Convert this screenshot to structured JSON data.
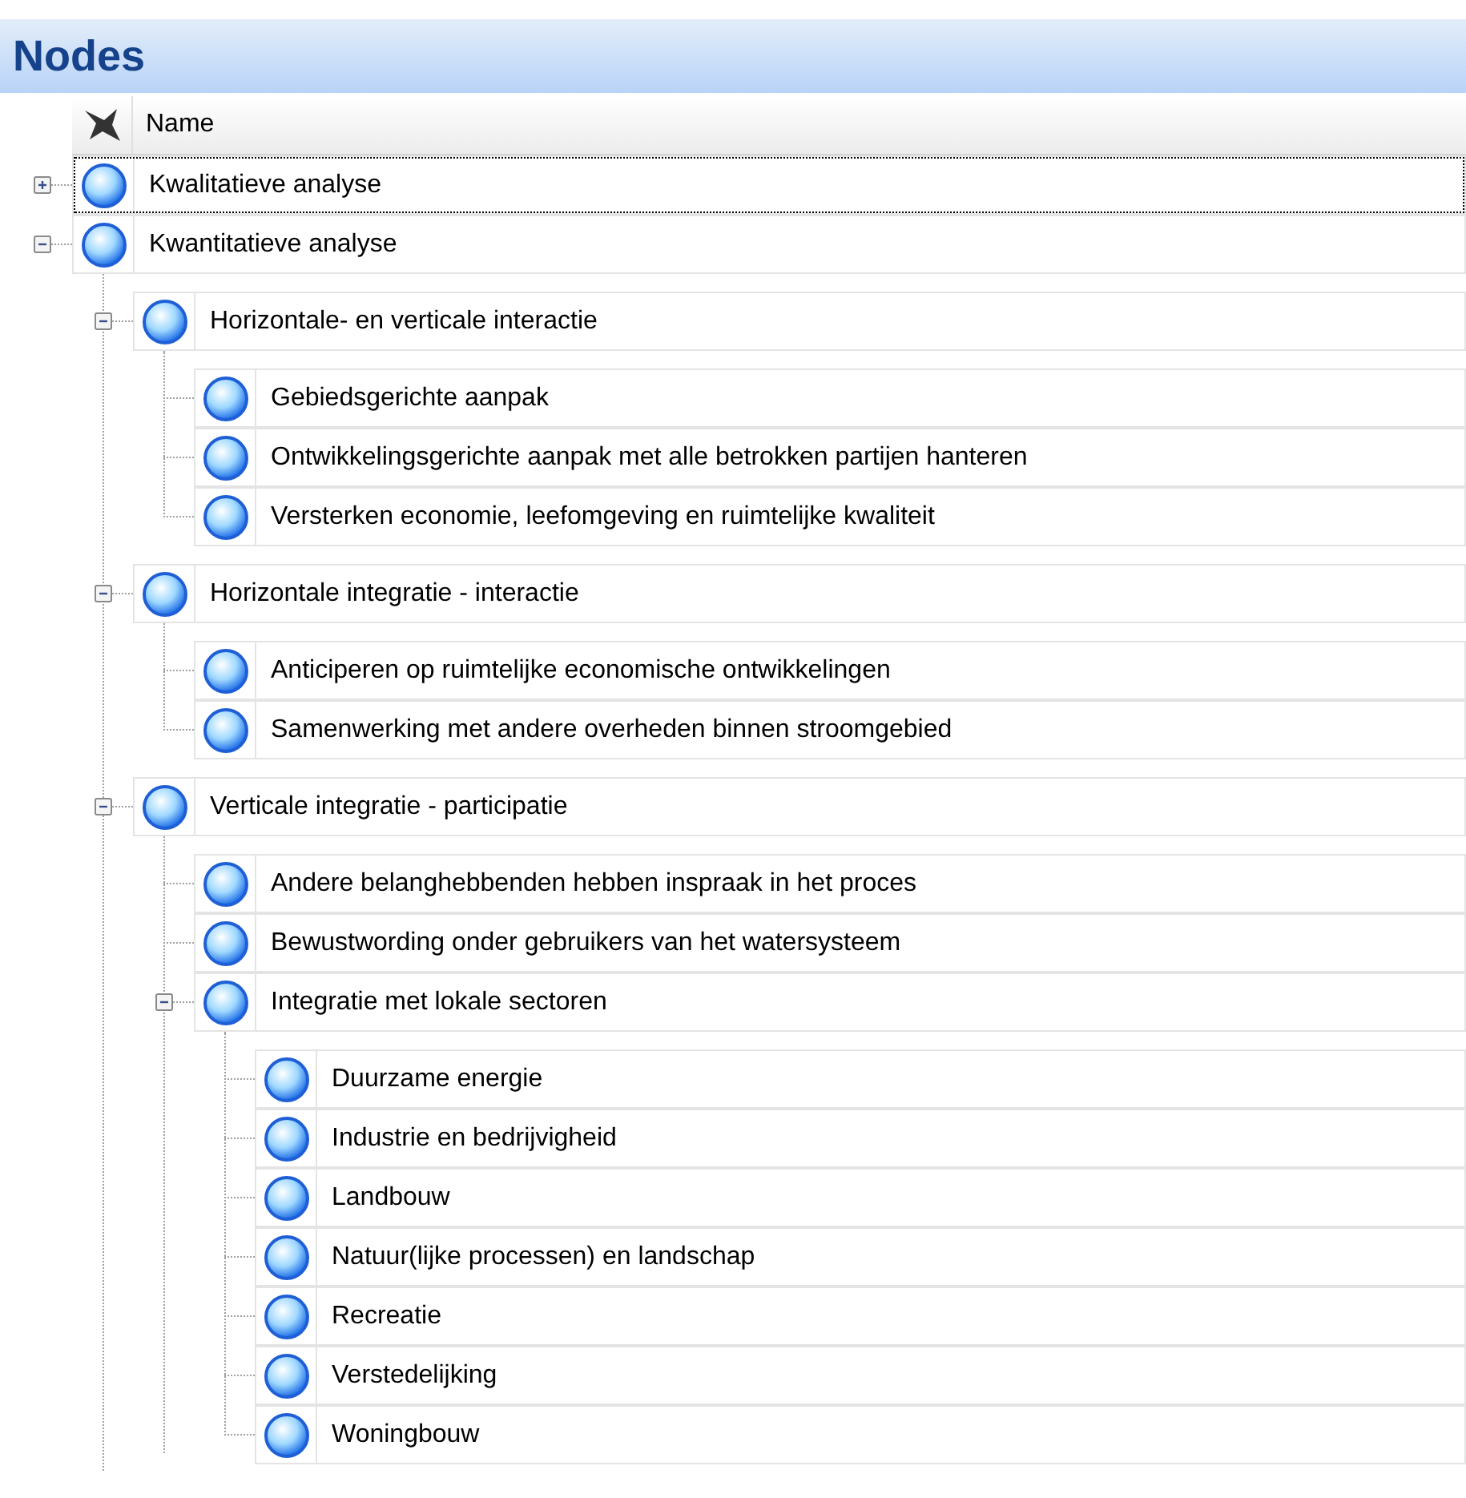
{
  "panel": {
    "title": "Nodes"
  },
  "columns": [
    {
      "label": "Name"
    }
  ],
  "nodes": [
    {
      "label": "Kwalitatieve analyse",
      "kind": "group",
      "expanded": false,
      "selected": true
    },
    {
      "label": "Kwantitatieve analyse",
      "kind": "group",
      "expanded": true,
      "selected": false,
      "children": [
        {
          "label": "Horizontale- en verticale interactie",
          "kind": "group",
          "expanded": true,
          "selected": false,
          "children": [
            {
              "label": "Gebiedsgerichte aanpak",
              "kind": "leaf",
              "selected": false
            },
            {
              "label": "Ontwikkelingsgerichte aanpak met alle betrokken partijen hanteren",
              "kind": "leaf",
              "selected": false
            },
            {
              "label": "Versterken economie, leefomgeving en ruimtelijke kwaliteit",
              "kind": "leaf",
              "selected": false
            }
          ]
        },
        {
          "label": "Horizontale integratie - interactie",
          "kind": "group",
          "expanded": true,
          "selected": false,
          "children": [
            {
              "label": "Anticiperen op ruimtelijke economische ontwikkelingen",
              "kind": "leaf",
              "selected": false
            },
            {
              "label": "Samenwerking met andere overheden binnen stroomgebied",
              "kind": "leaf",
              "selected": false
            }
          ]
        },
        {
          "label": "Verticale integratie - participatie",
          "kind": "group",
          "expanded": true,
          "selected": false,
          "children": [
            {
              "label": "Andere belanghebbenden hebben inspraak in het proces",
              "kind": "leaf",
              "selected": false
            },
            {
              "label": "Bewustwording onder gebruikers van het watersysteem",
              "kind": "leaf",
              "selected": false
            },
            {
              "label": "Integratie met lokale sectoren",
              "kind": "group",
              "expanded": true,
              "selected": false,
              "children": [
                {
                  "label": "Duurzame energie",
                  "kind": "leaf",
                  "selected": false
                },
                {
                  "label": "Industrie en bedrijvigheid",
                  "kind": "leaf",
                  "selected": false
                },
                {
                  "label": "Landbouw",
                  "kind": "leaf",
                  "selected": false
                },
                {
                  "label": "Natuur(lijke processen) en landschap",
                  "kind": "leaf",
                  "selected": false
                },
                {
                  "label": "Recreatie",
                  "kind": "leaf",
                  "selected": false
                },
                {
                  "label": "Verstedelijking",
                  "kind": "leaf",
                  "selected": false
                },
                {
                  "label": "Woningbouw",
                  "kind": "leaf",
                  "selected": false
                }
              ]
            }
          ]
        }
      ]
    }
  ]
}
